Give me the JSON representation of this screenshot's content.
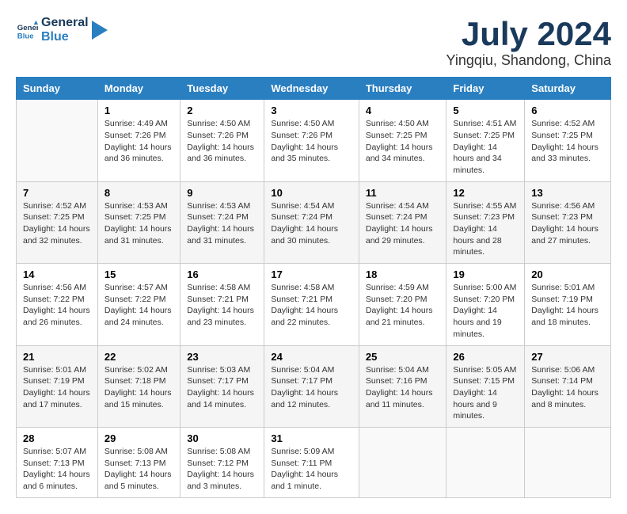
{
  "header": {
    "logo_line1": "General",
    "logo_line2": "Blue",
    "main_title": "July 2024",
    "subtitle": "Yingqiu, Shandong, China"
  },
  "columns": [
    "Sunday",
    "Monday",
    "Tuesday",
    "Wednesday",
    "Thursday",
    "Friday",
    "Saturday"
  ],
  "weeks": [
    [
      {
        "day": "",
        "sunrise": "",
        "sunset": "",
        "daylight": ""
      },
      {
        "day": "1",
        "sunrise": "4:49 AM",
        "sunset": "7:26 PM",
        "daylight": "14 hours and 36 minutes."
      },
      {
        "day": "2",
        "sunrise": "4:50 AM",
        "sunset": "7:26 PM",
        "daylight": "14 hours and 36 minutes."
      },
      {
        "day": "3",
        "sunrise": "4:50 AM",
        "sunset": "7:26 PM",
        "daylight": "14 hours and 35 minutes."
      },
      {
        "day": "4",
        "sunrise": "4:50 AM",
        "sunset": "7:25 PM",
        "daylight": "14 hours and 34 minutes."
      },
      {
        "day": "5",
        "sunrise": "4:51 AM",
        "sunset": "7:25 PM",
        "daylight": "14 hours and 34 minutes."
      },
      {
        "day": "6",
        "sunrise": "4:52 AM",
        "sunset": "7:25 PM",
        "daylight": "14 hours and 33 minutes."
      }
    ],
    [
      {
        "day": "7",
        "sunrise": "4:52 AM",
        "sunset": "7:25 PM",
        "daylight": "14 hours and 32 minutes."
      },
      {
        "day": "8",
        "sunrise": "4:53 AM",
        "sunset": "7:25 PM",
        "daylight": "14 hours and 31 minutes."
      },
      {
        "day": "9",
        "sunrise": "4:53 AM",
        "sunset": "7:24 PM",
        "daylight": "14 hours and 31 minutes."
      },
      {
        "day": "10",
        "sunrise": "4:54 AM",
        "sunset": "7:24 PM",
        "daylight": "14 hours and 30 minutes."
      },
      {
        "day": "11",
        "sunrise": "4:54 AM",
        "sunset": "7:24 PM",
        "daylight": "14 hours and 29 minutes."
      },
      {
        "day": "12",
        "sunrise": "4:55 AM",
        "sunset": "7:23 PM",
        "daylight": "14 hours and 28 minutes."
      },
      {
        "day": "13",
        "sunrise": "4:56 AM",
        "sunset": "7:23 PM",
        "daylight": "14 hours and 27 minutes."
      }
    ],
    [
      {
        "day": "14",
        "sunrise": "4:56 AM",
        "sunset": "7:22 PM",
        "daylight": "14 hours and 26 minutes."
      },
      {
        "day": "15",
        "sunrise": "4:57 AM",
        "sunset": "7:22 PM",
        "daylight": "14 hours and 24 minutes."
      },
      {
        "day": "16",
        "sunrise": "4:58 AM",
        "sunset": "7:21 PM",
        "daylight": "14 hours and 23 minutes."
      },
      {
        "day": "17",
        "sunrise": "4:58 AM",
        "sunset": "7:21 PM",
        "daylight": "14 hours and 22 minutes."
      },
      {
        "day": "18",
        "sunrise": "4:59 AM",
        "sunset": "7:20 PM",
        "daylight": "14 hours and 21 minutes."
      },
      {
        "day": "19",
        "sunrise": "5:00 AM",
        "sunset": "7:20 PM",
        "daylight": "14 hours and 19 minutes."
      },
      {
        "day": "20",
        "sunrise": "5:01 AM",
        "sunset": "7:19 PM",
        "daylight": "14 hours and 18 minutes."
      }
    ],
    [
      {
        "day": "21",
        "sunrise": "5:01 AM",
        "sunset": "7:19 PM",
        "daylight": "14 hours and 17 minutes."
      },
      {
        "day": "22",
        "sunrise": "5:02 AM",
        "sunset": "7:18 PM",
        "daylight": "14 hours and 15 minutes."
      },
      {
        "day": "23",
        "sunrise": "5:03 AM",
        "sunset": "7:17 PM",
        "daylight": "14 hours and 14 minutes."
      },
      {
        "day": "24",
        "sunrise": "5:04 AM",
        "sunset": "7:17 PM",
        "daylight": "14 hours and 12 minutes."
      },
      {
        "day": "25",
        "sunrise": "5:04 AM",
        "sunset": "7:16 PM",
        "daylight": "14 hours and 11 minutes."
      },
      {
        "day": "26",
        "sunrise": "5:05 AM",
        "sunset": "7:15 PM",
        "daylight": "14 hours and 9 minutes."
      },
      {
        "day": "27",
        "sunrise": "5:06 AM",
        "sunset": "7:14 PM",
        "daylight": "14 hours and 8 minutes."
      }
    ],
    [
      {
        "day": "28",
        "sunrise": "5:07 AM",
        "sunset": "7:13 PM",
        "daylight": "14 hours and 6 minutes."
      },
      {
        "day": "29",
        "sunrise": "5:08 AM",
        "sunset": "7:13 PM",
        "daylight": "14 hours and 5 minutes."
      },
      {
        "day": "30",
        "sunrise": "5:08 AM",
        "sunset": "7:12 PM",
        "daylight": "14 hours and 3 minutes."
      },
      {
        "day": "31",
        "sunrise": "5:09 AM",
        "sunset": "7:11 PM",
        "daylight": "14 hours and 1 minute."
      },
      {
        "day": "",
        "sunrise": "",
        "sunset": "",
        "daylight": ""
      },
      {
        "day": "",
        "sunrise": "",
        "sunset": "",
        "daylight": ""
      },
      {
        "day": "",
        "sunrise": "",
        "sunset": "",
        "daylight": ""
      }
    ]
  ],
  "labels": {
    "sunrise_prefix": "Sunrise: ",
    "sunset_prefix": "Sunset: ",
    "daylight_prefix": "Daylight: "
  }
}
